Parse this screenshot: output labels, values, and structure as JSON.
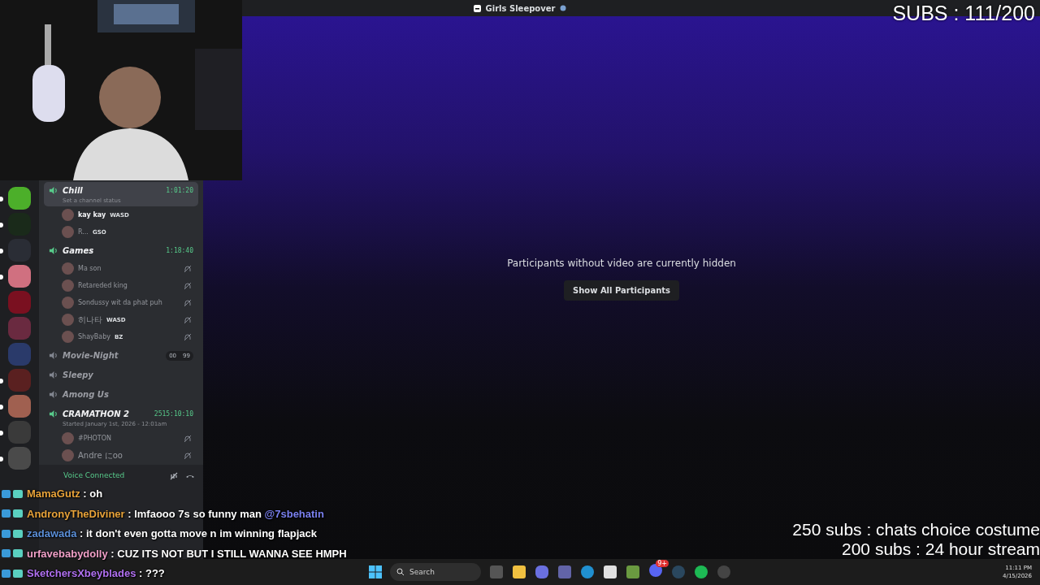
{
  "title_bar": {
    "title": "Girls Sleepover"
  },
  "subs_counter": "SUBS : 111/200",
  "servers": [
    {
      "unread": true,
      "color": "#4caf2a"
    },
    {
      "unread": true,
      "color": "#1a2a1a"
    },
    {
      "unread": true,
      "color": "#2a2d35"
    },
    {
      "unread": true,
      "color": "#d07080"
    },
    {
      "unread": false,
      "color": "#7a1020"
    },
    {
      "unread": false,
      "color": "#6a2a40"
    },
    {
      "unread": false,
      "color": "#2a3a6a"
    },
    {
      "unread": true,
      "color": "#5a2020"
    },
    {
      "unread": true,
      "color": "#a06050"
    },
    {
      "unread": true,
      "color": "#3a3a3a"
    },
    {
      "unread": true,
      "color": "#4a4a4a"
    }
  ],
  "channels": [
    {
      "name": "Chill",
      "selected": true,
      "active": true,
      "timer": "1:01:20",
      "status": "Set a channel status",
      "members": [
        {
          "name": "kay kay",
          "tag": "WASD",
          "muted": false,
          "bold": true
        },
        {
          "name": "R...",
          "tag": "GSO",
          "muted": false,
          "bold": false
        }
      ]
    },
    {
      "name": "Games",
      "selected": false,
      "active": true,
      "timer": "1:18:40",
      "members": [
        {
          "name": "Ma son",
          "muted": true,
          "bold": false
        },
        {
          "name": "Retareded king",
          "muted": true,
          "bold": false
        },
        {
          "name": "Sondussy wit da phat puh",
          "muted": true,
          "bold": false
        },
        {
          "name": "히나타",
          "tag": "WASD",
          "muted": true,
          "bold": false
        },
        {
          "name": "ShayBaby",
          "tag": "BZ",
          "muted": true,
          "bold": false
        }
      ]
    },
    {
      "name": "Movie-Night",
      "selected": false,
      "active": false,
      "counter": [
        "00",
        "99"
      ]
    },
    {
      "name": "Sleepy",
      "selected": false,
      "active": false
    },
    {
      "name": "Among Us",
      "selected": false,
      "active": false
    },
    {
      "name": "CRAMATHON 2",
      "selected": false,
      "active": true,
      "timer": "2515:10:10",
      "status": "Started January 1st, 2026 - 12:01am",
      "members": [
        {
          "name": "#PHOTON",
          "muted": true,
          "bold": false
        },
        {
          "name": "Andre にoo",
          "muted": true,
          "bold": false
        }
      ]
    }
  ],
  "voice_panel": {
    "title": "Voice Connected"
  },
  "stage": {
    "message": "Participants without video are currently hidden",
    "button": "Show All Participants"
  },
  "goals": [
    "250 subs : chats choice costume",
    "200 subs : 24 hour stream"
  ],
  "chat": [
    {
      "user": "MamaGutz",
      "color": "#e8a33a",
      "text": ": oh"
    },
    {
      "user": "AndronyTheDiviner",
      "color": "#e8a33a",
      "text": ": lmfaooo 7s so funny man",
      "mention": "@7sbehatin"
    },
    {
      "user": "zadawada",
      "color": "#5b8fd8",
      "text": ": it don't even gotta move n im winning flapjack"
    },
    {
      "user": "urfavebabydolly",
      "color": "#f0a0c8",
      "text": ": CUZ ITS NOT BUT I STILL WANNA SEE HMPH"
    },
    {
      "user": "SketchersXbeyblades",
      "color": "#b070f0",
      "text": ": ???"
    }
  ],
  "taskbar": {
    "search": "Search",
    "badge": "9+",
    "time": "11:11 PM",
    "date": "4/15/2026"
  }
}
